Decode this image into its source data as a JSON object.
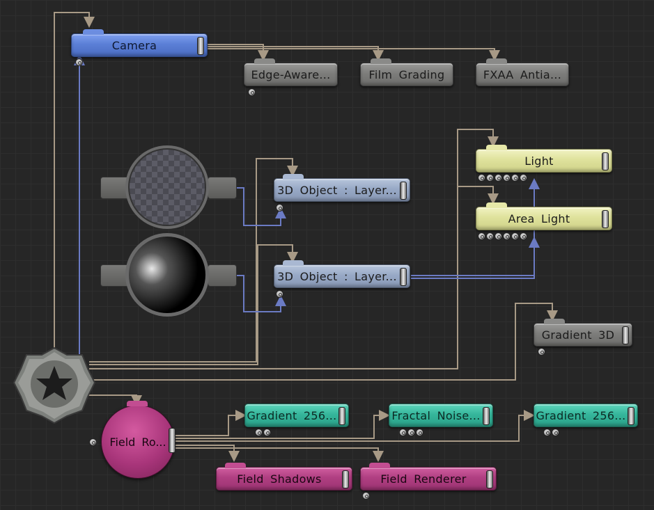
{
  "nodes": {
    "camera": "Camera",
    "edge_aware": "Edge-Aware...",
    "film_grading": "Film  Grading",
    "fxaa": "FXAA  Antia...",
    "light": "Light",
    "area_light": "Area  Light",
    "obj3d_a": "3D  Object  :  Layer...",
    "obj3d_b": "3D  Object  :  Layer...",
    "gradient3d": "Gradient  3D",
    "gradient256_a": "Gradient  256...",
    "fractal_noise": "Fractal  Noise...",
    "gradient256_b": "Gradient  256...",
    "field_ro": "Field  Ro...",
    "field_shadows": "Field  Shadows",
    "field_renderer": "Field  Renderer"
  },
  "colors": {
    "blue": "#5b7fd6",
    "gray": "#7d7d7b",
    "steel": "#98a9c6",
    "yellow": "#dfe29c",
    "teal": "#35b69b",
    "magenta": "#b03f82",
    "wire_tan": "#a89a86",
    "wire_blue": "#6b7bc4"
  },
  "icons": [
    "root-gear-icon",
    "checker-sphere-preview",
    "black-sphere-preview",
    "port-icon"
  ]
}
